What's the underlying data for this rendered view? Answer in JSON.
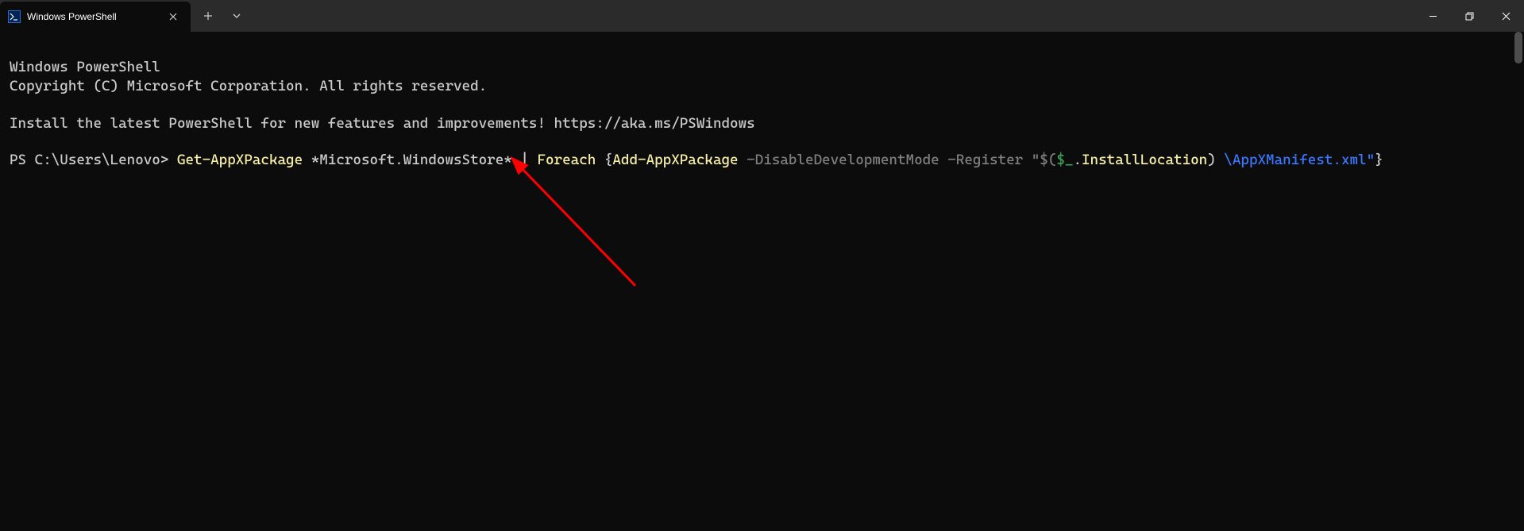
{
  "titlebar": {
    "tab_title": "Windows PowerShell",
    "close_tab_icon": "✕",
    "new_tab_icon": "+",
    "dropdown_icon": "⌄",
    "minimize_icon": "minimize",
    "maximize_icon": "maximize",
    "close_icon": "close"
  },
  "terminal": {
    "line1": "Windows PowerShell",
    "line2": "Copyright (C) Microsoft Corporation. All rights reserved.",
    "line3": "Install the latest PowerShell for new features and improvements! https://aka.ms/PSWindows",
    "prompt": "PS C:\\Users\\Lenovo> ",
    "command": {
      "cmdlet1": "Get-AppXPackage",
      "arg1": " *Microsoft.WindowsStore* ",
      "pipe": "| ",
      "foreach": "Foreach",
      "space1": " ",
      "lbrace": "{",
      "cmdlet2": "Add-AppXPackage",
      "params": " -DisableDevelopmentMode -Register ",
      "qstart": "\"$(",
      "var": "$_",
      "dot": ".",
      "member1": "InstallLocation",
      "rparen": ")",
      "path": " \\AppXManifest.xml\"",
      "rbrace": "}"
    }
  },
  "colors": {
    "background": "#0c0c0c",
    "titlebar": "#2b2b2b",
    "text": "#cccccc",
    "cmdlet": "#f9f1a5",
    "param": "#808080",
    "variable": "#3aa655",
    "path": "#3b78ff",
    "arrow": "#ff0000"
  }
}
